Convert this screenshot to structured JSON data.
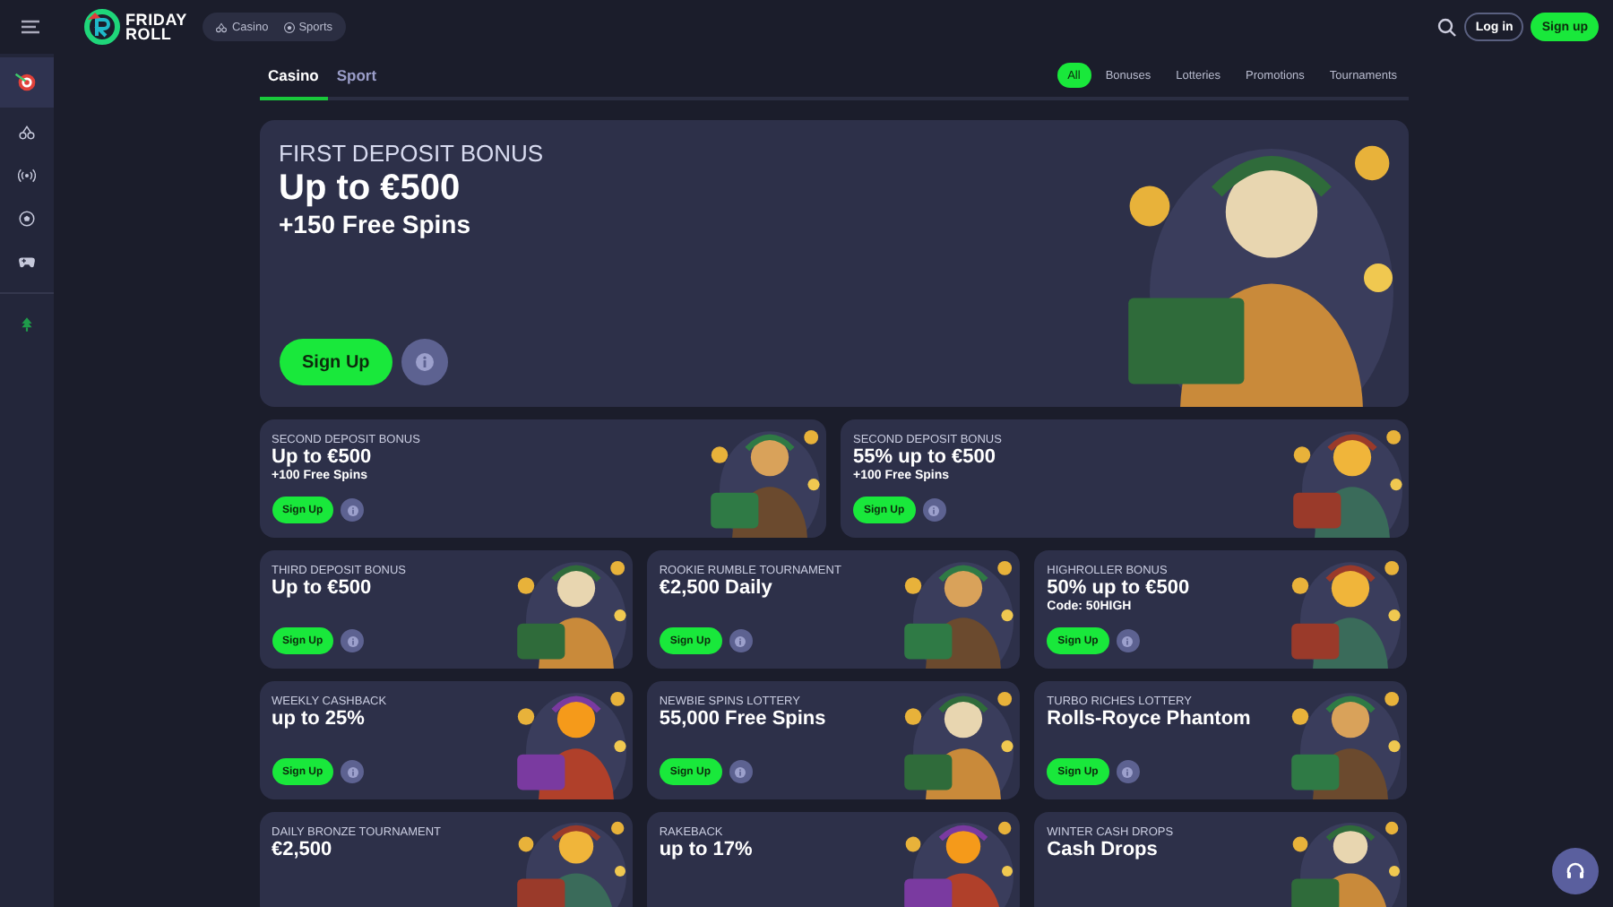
{
  "header": {
    "logo": {
      "line1": "FRIDAY",
      "line2": "ROLL"
    },
    "switcher": [
      {
        "kind": "cherries",
        "label": "Casino"
      },
      {
        "kind": "ball",
        "label": "Sports"
      }
    ],
    "login": "Log in",
    "signup": "Sign up"
  },
  "sidebar": {
    "items": [
      {
        "kind": "target",
        "selected": true
      },
      {
        "kind": "cherries",
        "selected": false
      },
      {
        "kind": "live",
        "selected": false
      },
      {
        "kind": "ball",
        "selected": false
      },
      {
        "kind": "gamepad",
        "selected": false
      },
      {
        "kind": "tree",
        "selected": false
      }
    ]
  },
  "tabs": [
    {
      "label": "Casino",
      "selected": true
    },
    {
      "label": "Sport",
      "selected": false
    }
  ],
  "filters": [
    {
      "label": "All",
      "selected": true
    },
    {
      "label": "Bonuses",
      "selected": false
    },
    {
      "label": "Lotteries",
      "selected": false
    },
    {
      "label": "Promotions",
      "selected": false
    },
    {
      "label": "Tournaments",
      "selected": false
    }
  ],
  "hero": {
    "label": "FIRST DEPOSIT BONUS",
    "title": "Up to €500",
    "subtitle": "+150 Free Spins",
    "cta": "Sign Up"
  },
  "rows": [
    [
      {
        "label": "SECOND DEPOSIT BONUS",
        "title": "Up to €500",
        "note": "+100 Free Spins",
        "cta": "Sign Up"
      },
      {
        "label": "SECOND DEPOSIT BONUS",
        "title": "55% up to €500",
        "note": "+100 Free Spins",
        "cta": "Sign Up"
      }
    ],
    [
      {
        "label": "THIRD DEPOSIT BONUS",
        "title": "Up to €500",
        "cta": "Sign Up"
      },
      {
        "label": "ROOKIE RUMBLE TOURNAMENT",
        "title": "€2,500 Daily",
        "cta": "Sign Up"
      },
      {
        "label": "HIGHROLLER BONUS",
        "title": "50% up to €500",
        "note": "Code: 50HIGH",
        "cta": "Sign Up"
      }
    ],
    [
      {
        "label": "WEEKLY CASHBACK",
        "title": "up to 25%",
        "cta": "Sign Up"
      },
      {
        "label": "NEWBIE SPINS LOTTERY",
        "title": "55,000 Free Spins",
        "cta": "Sign Up"
      },
      {
        "label": "TURBO RICHES LOTTERY",
        "title": "Rolls-Royce Phantom",
        "cta": "Sign Up"
      }
    ],
    [
      {
        "label": "DAILY BRONZE TOURNAMENT",
        "title": "€2,500"
      },
      {
        "label": "RAKEBACK",
        "title": "up to 17%"
      },
      {
        "label": "WINTER CASH DROPS",
        "title": "Cash Drops"
      }
    ]
  ]
}
